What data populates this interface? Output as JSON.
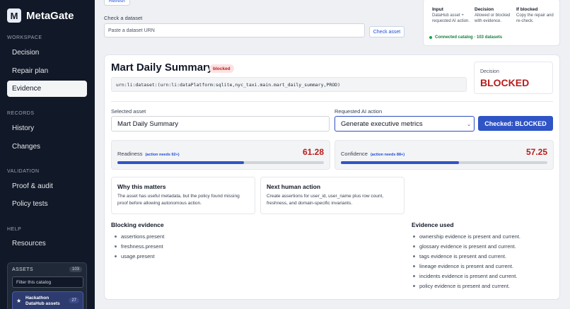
{
  "brand": {
    "logo": "M",
    "name": "MetaGate"
  },
  "sidebar": {
    "sections": [
      "WORKSPACE",
      "RECORDS",
      "VALIDATION",
      "HELP"
    ],
    "items": [
      {
        "label": "Decision"
      },
      {
        "label": "Repair plan"
      },
      {
        "label": "Evidence",
        "active": true
      },
      {
        "label": "History"
      },
      {
        "label": "Changes"
      },
      {
        "label": "Proof & audit"
      },
      {
        "label": "Policy tests"
      },
      {
        "label": "Resources"
      }
    ],
    "assets": {
      "label": "ASSETS",
      "count": "103",
      "filter_placeholder": "Filter this catalog",
      "card": {
        "icon": "star-icon",
        "name": "Hackathon DataHub assets",
        "count": "27"
      }
    }
  },
  "top": {
    "refresh_label": "Refresh",
    "check_label": "Check a dataset",
    "urn_placeholder": "Paste a dataset URN",
    "check_button": "Check asset",
    "legend": [
      {
        "title": "Input",
        "text": "DataHub asset + requested AI action."
      },
      {
        "title": "Decision",
        "text": "Allowed or blocked with evidence."
      },
      {
        "title": "If blocked",
        "text": "Copy the repair and re-check."
      }
    ],
    "connected": "Connected catalog · 103 datasets"
  },
  "main": {
    "title": "Mart Daily Summary",
    "status_badge": "blocked",
    "urn": "urn:li:dataset:(urn:li:dataPlatform:sqlite,nyc_taxi.main.mart_daily_summary,PROD)",
    "decision": {
      "label": "Decision",
      "value": "BLOCKED"
    },
    "selected_asset": {
      "label": "Selected asset",
      "value": "Mart Daily Summary"
    },
    "requested_action": {
      "label": "Requested AI action",
      "value": "Generate executive metrics"
    },
    "checked_button": "Checked: BLOCKED",
    "readiness": {
      "label": "Readiness",
      "note": "(action needs 92+)",
      "value": "61.28",
      "fraction": 0.6128
    },
    "confidence": {
      "label": "Confidence",
      "note": "(action needs 88+)",
      "value": "57.25",
      "fraction": 0.5725
    },
    "why": {
      "title": "Why this matters",
      "text": "The asset has useful metadata, but the policy found missing proof before allowing autonomous action."
    },
    "next": {
      "title": "Next human action",
      "text": "Create assertions for user_id, user_name plus row count, freshness, and domain-specific invariants."
    },
    "blocking": {
      "title": "Blocking evidence",
      "items": [
        "assertions.present",
        "freshness.present",
        "usage.present"
      ]
    },
    "used": {
      "title": "Evidence used",
      "items": [
        "ownership evidence is present and current.",
        "glossary evidence is present and current.",
        "tags evidence is present and current.",
        "lineage evidence is present and current.",
        "incidents evidence is present and current.",
        "policy evidence is present and current."
      ]
    }
  },
  "colors": {
    "accent": "#2f54c6",
    "blocked": "#b91c1c",
    "connected": "#15803d",
    "sidebar": "#111827"
  }
}
